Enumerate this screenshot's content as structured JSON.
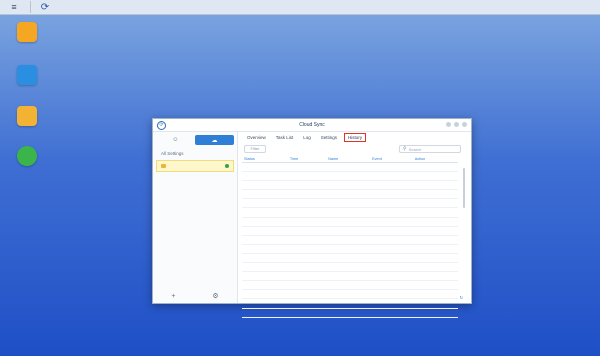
{
  "taskbar": {
    "menu_glyph": "≡",
    "app_glyph": "⟳"
  },
  "desktop_icons": [
    {
      "label": "",
      "color": "#f5a623",
      "icon": "package-center-icon"
    },
    {
      "label": "",
      "color": "#2a8fe0",
      "icon": "mobile-app-icon"
    },
    {
      "label": "",
      "color": "#f2b233",
      "icon": "file-station-icon"
    },
    {
      "label": "",
      "color": "#3bb54a",
      "icon": "help-icon"
    }
  ],
  "window": {
    "title": "Cloud Sync",
    "app_glyph": "⟳",
    "left_tabs": [
      "☺",
      "☁"
    ],
    "group_label": "All Settings",
    "connection_name": "",
    "add_glyph": "+",
    "settings_glyph": "⚙",
    "tabs": [
      "Overview",
      "Task List",
      "Log",
      "Settings",
      "History"
    ],
    "active_tab": 4,
    "filter_label": "Filter",
    "search_placeholder": "Search",
    "columns": [
      "Status",
      "Time",
      "Name",
      "Event",
      "Action"
    ],
    "rows": [
      {
        "status": "",
        "time": "",
        "name": "",
        "event": "",
        "action": ""
      },
      {
        "status": "",
        "time": "",
        "name": "",
        "event": "",
        "action": ""
      },
      {
        "status": "",
        "time": "",
        "name": "",
        "event": "",
        "action": ""
      },
      {
        "status": "",
        "time": "",
        "name": "",
        "event": "",
        "action": ""
      },
      {
        "status": "",
        "time": "",
        "name": "",
        "event": "",
        "action": ""
      },
      {
        "status": "",
        "time": "",
        "name": "",
        "event": "",
        "action": ""
      },
      {
        "status": "",
        "time": "",
        "name": "",
        "event": "",
        "action": ""
      },
      {
        "status": "",
        "time": "",
        "name": "",
        "event": "",
        "action": ""
      },
      {
        "status": "",
        "time": "",
        "name": "",
        "event": "",
        "action": ""
      },
      {
        "status": "",
        "time": "",
        "name": "",
        "event": "",
        "action": ""
      },
      {
        "status": "",
        "time": "",
        "name": "",
        "event": "",
        "action": ""
      },
      {
        "status": "",
        "time": "",
        "name": "",
        "event": "",
        "action": ""
      },
      {
        "status": "",
        "time": "",
        "name": "",
        "event": "",
        "action": ""
      },
      {
        "status": "",
        "time": "",
        "name": "",
        "event": "",
        "action": ""
      },
      {
        "status": "",
        "time": "",
        "name": "",
        "event": "",
        "action": ""
      },
      {
        "status": "",
        "time": "",
        "name": "",
        "event": "",
        "action": ""
      },
      {
        "status": "",
        "time": "",
        "name": "",
        "event": "",
        "action": ""
      }
    ],
    "footer_text": ""
  },
  "colors": {
    "accent": "#2f7fd6",
    "highlight": "#e2332b",
    "status_ok": "#3aa14a"
  }
}
